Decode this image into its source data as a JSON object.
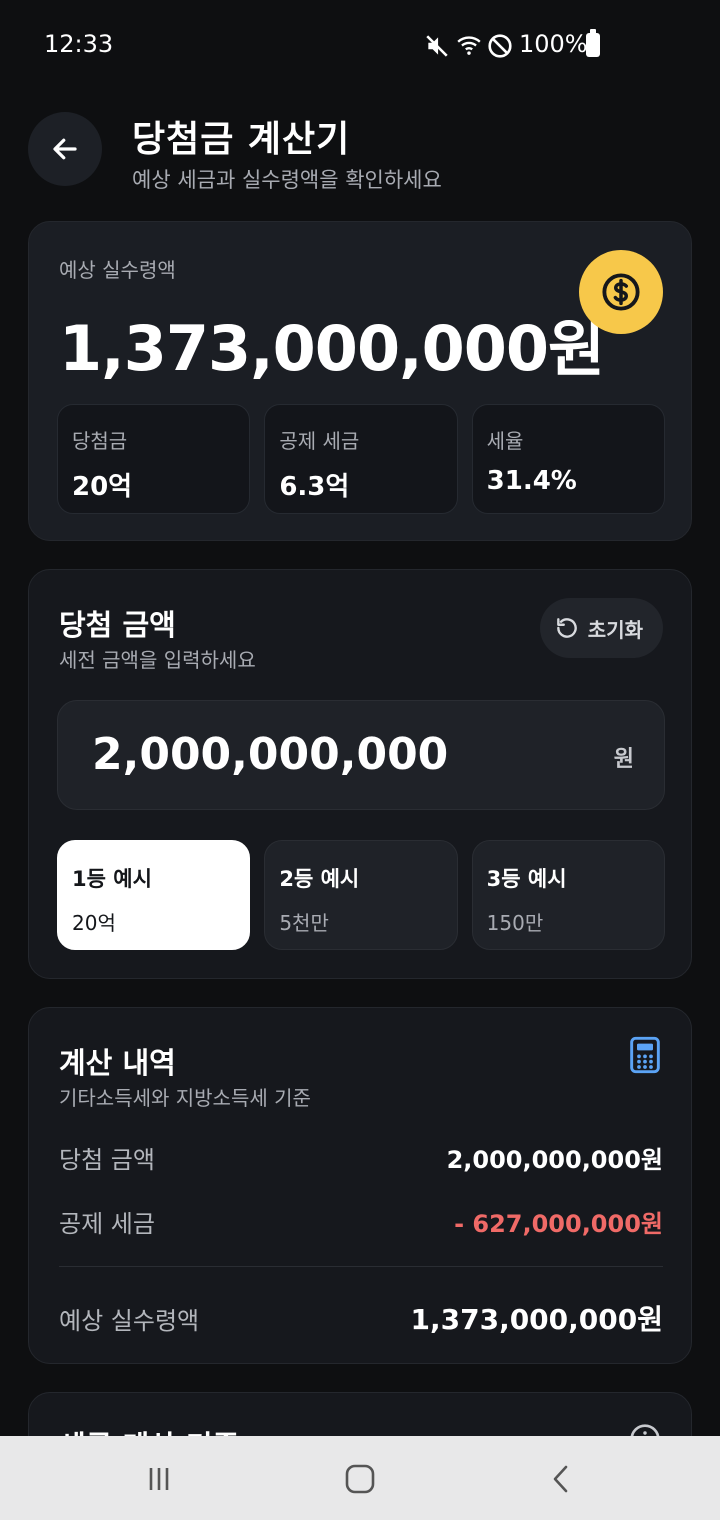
{
  "status": {
    "time": "12:33",
    "battery": "100%"
  },
  "header": {
    "title": "당첨금 계산기",
    "subtitle": "예상 세금과 실수령액을 확인하세요"
  },
  "summary": {
    "label": "예상 실수령액",
    "amount": "1,373,000,000원",
    "stats": [
      {
        "label": "당첨금",
        "value": "20억"
      },
      {
        "label": "공제 세금",
        "value": "6.3억"
      },
      {
        "label": "세율",
        "value": "31.4%"
      }
    ]
  },
  "input_section": {
    "title": "당첨 금액",
    "subtitle": "세전 금액을 입력하세요",
    "reset_label": "초기화",
    "amount_value": "2,000,000,000",
    "unit": "원",
    "presets": [
      {
        "name": "1등 예시",
        "amount": "20억",
        "selected": true
      },
      {
        "name": "2등 예시",
        "amount": "5천만",
        "selected": false
      },
      {
        "name": "3등 예시",
        "amount": "150만",
        "selected": false
      }
    ]
  },
  "breakdown": {
    "title": "계산 내역",
    "subtitle": "기타소득세와 지방소득세 기준",
    "rows": [
      {
        "label": "당첨 금액",
        "value": "2,000,000,000원"
      },
      {
        "label": "공제 세금",
        "value": "- 627,000,000원"
      }
    ],
    "total": {
      "label": "예상 실수령액",
      "value": "1,373,000,000원"
    }
  },
  "next_section": {
    "title": "세금 계산 기준"
  },
  "colors": {
    "accent_yellow": "#f7c84a",
    "negative_red": "#f06a67",
    "calc_icon_blue": "#5ba3f5"
  }
}
